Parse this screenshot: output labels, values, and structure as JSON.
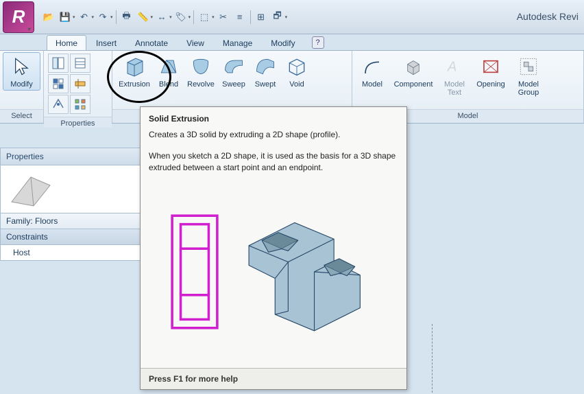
{
  "app": {
    "title": "Autodesk Revi",
    "logo_letter": "R"
  },
  "qat": {
    "open": "open",
    "save": "save",
    "undo": "undo",
    "redo": "redo",
    "print": "print",
    "measure": "measure",
    "dim": "dim",
    "tag": "tag",
    "view3d": "view3d",
    "section": "section",
    "thin": "thin",
    "close": "close",
    "sync": "sync",
    "switch": "switch"
  },
  "tabs": {
    "items": [
      "Home",
      "Insert",
      "Annotate",
      "View",
      "Manage",
      "Modify"
    ],
    "active": 0,
    "help": "?"
  },
  "ribbon": {
    "select": {
      "title": "Select",
      "modify": "Modify"
    },
    "properties": {
      "title": "Properties"
    },
    "forms": {
      "extrusion": "Extrusion",
      "blend": "Blend",
      "revolve": "Revolve",
      "sweep": "Sweep",
      "swept": "Swept",
      "void": "Void"
    },
    "model": {
      "title": "Model",
      "modelline": "Model",
      "component": "Component",
      "modeltext": "Model\nText",
      "opening": "Opening",
      "modelgroup": "Model\nGroup"
    }
  },
  "tooltip": {
    "title": "Solid Extrusion",
    "desc": "Creates a 3D solid by extruding a 2D shape (profile).",
    "detail": "When you sketch a 2D shape, it is used as the basis for a 3D shape extruded between a start point and an endpoint.",
    "footer": "Press F1 for more help"
  },
  "palette": {
    "header": "Properties",
    "family": "Family: Floors",
    "cat": "Constraints",
    "row1": "Host"
  }
}
